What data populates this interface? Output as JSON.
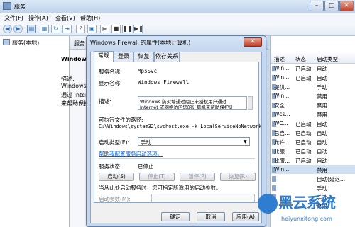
{
  "window": {
    "title": "服务"
  },
  "menu": [
    "文件(F)",
    "操作(A)",
    "查看(V)",
    "帮助(H)"
  ],
  "toolbar": {
    "items": [
      "back-icon",
      "forward-icon",
      "console-tree-icon",
      "properties-icon",
      "refresh-icon",
      "export-icon",
      "help-icon",
      "info-icon",
      "play-icon",
      "stop-icon",
      "pause-icon",
      "restart-icon"
    ]
  },
  "tree": {
    "label": "服务(本地)"
  },
  "center": {
    "header": "服务",
    "title": "Windows",
    "desc_label": "描述:",
    "desc_lines": [
      "Windows I",
      "通过 Intern",
      "来帮助保护"
    ]
  },
  "list": {
    "columns": [
      "描述",
      "状态",
      "启动类型"
    ],
    "rows": [
      [
        "Win...",
        "已启动",
        "自动"
      ],
      [
        "Win...",
        "已启动",
        "自动"
      ],
      [
        "提供...",
        "",
        "手动"
      ],
      [
        "Win...",
        "",
        "禁用"
      ],
      [
        "安全...",
        "",
        "禁用"
      ],
      [
        "Wcs...",
        "",
        "禁用"
      ],
      [
        "WC...",
        "已启动",
        "自动"
      ],
      [
        "已启...",
        "已启动",
        "自动"
      ],
      [
        "允许...",
        "已启动",
        "自动"
      ],
      [
        "此服...",
        "已启动",
        "自动"
      ],
      [
        "此服...",
        "已启动",
        "自动"
      ],
      [
        "Win...",
        "",
        "禁用"
      ],
      [
        "",
        "",
        "自动(延迟..."
      ],
      [
        "",
        "",
        "手动"
      ],
      [
        "",
        "",
        "手动"
      ],
      [
        "",
        "",
        "禁用"
      ]
    ]
  },
  "dialog": {
    "title": "Windows Firewall 的属性(本地计算机)",
    "tabs": [
      "常规",
      "登录",
      "恢复",
      "依存关系"
    ],
    "service_name_label": "服务名称:",
    "service_name": "MpsSvc",
    "display_name_label": "显示名称:",
    "display_name": "Windows Firewall",
    "description_label": "描述:",
    "description_lines": [
      "Windows 防火墙通过阻止未授权用户通过",
      "Internet 或网络访问您的计算机来帮助保护计"
    ],
    "path_label": "可执行文件的路径:",
    "path": "C:\\Windows\\system32\\svchost.exe -k LocalServiceNoNetwork",
    "startup_type_label": "启动类型(E):",
    "startup_type": "手动",
    "help_link": "帮助我配置服务启动选项。",
    "status_label": "服务状态:",
    "status": "已停止",
    "buttons": {
      "start": "启动(S)",
      "stop": "停止(T)",
      "pause": "暂停(P)",
      "resume": "恢复(R)"
    },
    "hint": "当从此处启动服务时，您可指定所适用的启动参数。",
    "param_label": "启动参数(M):",
    "param_value": "",
    "ok": "确定",
    "cancel": "取消",
    "apply": "应用(A)"
  },
  "watermark": {
    "text": "黑云系统",
    "url": "heiyunxitong.com"
  }
}
